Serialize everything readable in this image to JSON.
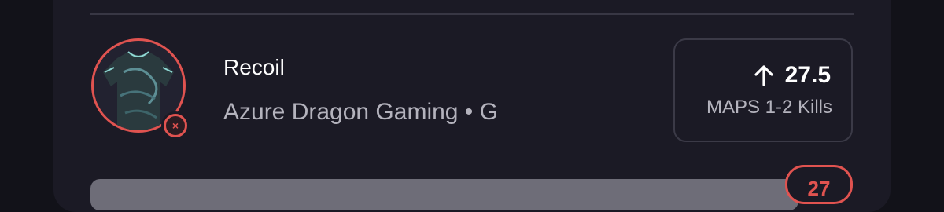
{
  "player": {
    "name": "Recoil",
    "team_position": "Azure Dragon Gaming • G",
    "avatar_icon": "jersey-icon",
    "remove_icon": "close-icon"
  },
  "projection": {
    "direction_icon": "arrow-up-icon",
    "value": "27.5",
    "label": "MAPS 1-2 Kills"
  },
  "result": {
    "score": "27"
  },
  "colors": {
    "accent_red": "#e05350",
    "background": "#121219",
    "card": "#1b1a25",
    "text_primary": "#ffffff",
    "text_secondary": "#b4b3bd"
  }
}
